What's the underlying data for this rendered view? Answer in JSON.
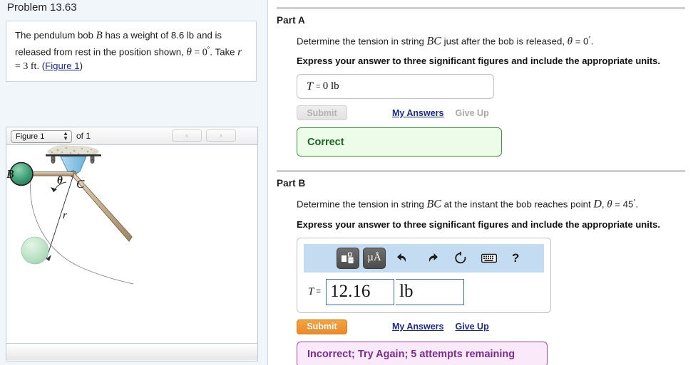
{
  "problem": {
    "title": "Problem 13.63",
    "statement_part1": "The pendulum bob ",
    "var_B": "B",
    "statement_part2": " has a weight of 8.6  lb and is released from rest in the position shown, ",
    "theta_sym": "θ",
    "theta_eq": " = 0",
    "deg": "°",
    "statement_part3": ". Take ",
    "var_r": "r",
    "r_eq": " = 3 ft",
    "statement_part4": ". (",
    "figure_link": "Figure 1",
    "statement_part5": ")"
  },
  "figure": {
    "selected": "Figure 1",
    "options": [
      "Figure 1"
    ],
    "of_label": "of 1",
    "prev_label": "‹",
    "next_label": "›",
    "labels": {
      "B": "B",
      "C": "C",
      "theta": "θ",
      "r": "r"
    },
    "colors": {
      "bob_dark_green": "#3f9e76",
      "bob_light_green": "#b9e0c4",
      "rod_tan": "#c9b190",
      "support_blue": "#9ecbe8",
      "ceiling_gray": "#dcd8c8"
    }
  },
  "partA": {
    "title": "Part A",
    "question_pre": "Determine the tension in string ",
    "question_bc": "BC",
    "question_mid": " just after the bob is released, ",
    "theta": "θ",
    "theta_val": " = 0",
    "deg": "°",
    "question_end": ".",
    "instruction": "Express your answer to three significant figures and include the appropriate units.",
    "answer_label": "T",
    "answer_eq": "=",
    "answer_value": "0 lb",
    "submit_label": "Submit",
    "my_answers_label": "My Answers",
    "give_up_label": "Give Up",
    "feedback": "Correct",
    "feedback_color": "#17661d"
  },
  "partB": {
    "title": "Part B",
    "question_pre": "Determine the tension in string ",
    "question_bc": "BC",
    "question_mid": " at the instant the bob reaches point ",
    "point_d": "D",
    "comma": ", ",
    "theta": "θ",
    "theta_val": " = 45",
    "deg": "°",
    "question_end": ".",
    "instruction": "Express your answer to three significant figures and include the appropriate units.",
    "toolbar": {
      "template_icon": "math-template-icon",
      "units_icon": "µÅ",
      "undo_icon": "↶",
      "redo_icon": "↷",
      "reset_icon": "↺",
      "keyboard_icon": "keyboard-icon",
      "help_label": "?"
    },
    "answer_label": "T",
    "answer_eq": "=",
    "answer_value": "12.16",
    "answer_unit": "lb",
    "submit_label": "Submit",
    "my_answers_label": "My Answers",
    "give_up_label": "Give Up",
    "feedback": "Incorrect; Try Again; 5 attempts remaining",
    "feedback_color": "#7b2d8e"
  }
}
